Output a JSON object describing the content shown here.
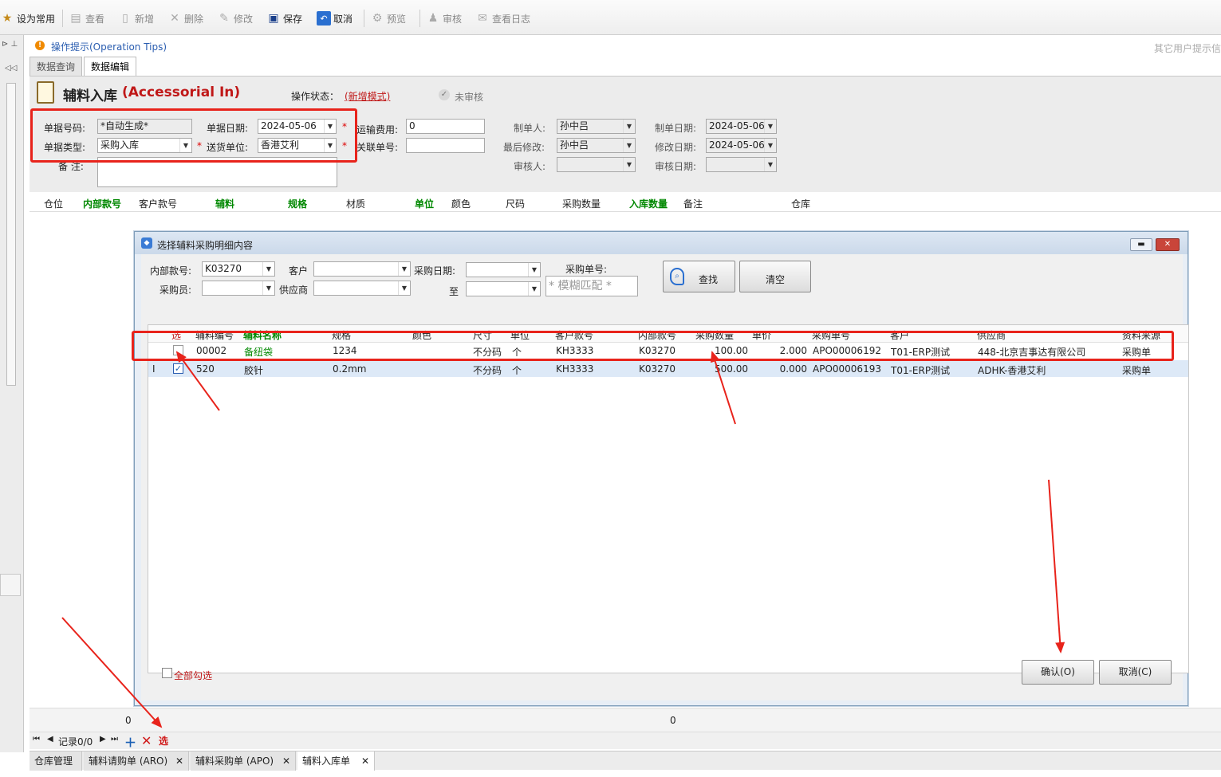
{
  "toolbar": {
    "set_common": "设为常用",
    "view": "查看",
    "add": "新增",
    "delete": "删除",
    "edit": "修改",
    "save": "保存",
    "cancel": "取消",
    "preview": "预览",
    "audit": "审核",
    "view_log": "查看日志"
  },
  "tips": {
    "label": "操作提示(Operation Tips)",
    "right": "其它用户提示信"
  },
  "tabs": [
    "数据查询",
    "数据编辑"
  ],
  "form": {
    "title_cn": "辅料入库",
    "title_en": "(Accessorial In)",
    "status_label": "操作状态：",
    "status_value": "(新增模式)",
    "audit_state": "未审核",
    "doc_no_label": "单据号码:",
    "doc_no_value": "*自动生成*",
    "doc_date_label": "单据日期:",
    "doc_date_value": "2024-05-06",
    "doc_type_label": "单据类型:",
    "doc_type_value": "采购入库",
    "delivery_label": "送货单位:",
    "delivery_value": "香港艾利",
    "freight_label": "运输费用:",
    "freight_value": "0",
    "related_label": "关联单号:",
    "related_value": "",
    "remark_label": "备  注:",
    "maker_label": "制单人:",
    "maker_value": "孙中吕",
    "last_mod_label": "最后修改:",
    "last_mod_value": "孙中吕",
    "auditor_label": "审核人:",
    "make_date_label": "制单日期:",
    "make_date_value": "2024-05-06",
    "mod_date_label": "修改日期:",
    "mod_date_value": "2024-05-06",
    "audit_date_label": "审核日期:"
  },
  "grid_headers": [
    "仓位",
    "内部款号",
    "客户款号",
    "辅料",
    "规格",
    "材质",
    "单位",
    "颜色",
    "尺码",
    "采购数量",
    "入库数量",
    "备注",
    "仓库"
  ],
  "dialog": {
    "title": "选择辅料采购明细内容",
    "inner_no_label": "内部款号:",
    "inner_no_value": "K03270",
    "customer_label": "客户",
    "purchase_date_label": "采购日期:",
    "to_label": "至",
    "purchase_no_label": "采购单号:",
    "purchase_no_placeholder": "* 模糊匹配 *",
    "buyer_label": "采购员:",
    "supplier_label": "供应商",
    "search_btn": "查找",
    "clear_btn": "清空",
    "headers": [
      "选",
      "辅料编号",
      "辅料名称",
      "规格",
      "颜色",
      "尺寸",
      "单位",
      "客户款号",
      "内部款号",
      "采购数量",
      "单价",
      "采购单号",
      "客户",
      "供应商",
      "资料来源"
    ],
    "rows": [
      {
        "checked": false,
        "code": "00002",
        "name": "备纽袋",
        "spec": "1234",
        "color": "",
        "size": "不分码",
        "unit": "个",
        "cust_no": "KH3333",
        "inner_no": "K03270",
        "qty": "100.00",
        "price": "2.000",
        "po": "APO00006192",
        "customer": "T01-ERP测试",
        "supplier": "448-北京吉事达有限公司",
        "source": "采购单"
      },
      {
        "checked": true,
        "code": "520",
        "name": "胶针",
        "spec": "0.2mm",
        "color": "",
        "size": "不分码",
        "unit": "个",
        "cust_no": "KH3333",
        "inner_no": "K03270",
        "qty": "500.00",
        "price": "0.000",
        "po": "APO00006193",
        "customer": "T01-ERP测试",
        "supplier": "ADHK-香港艾利",
        "source": "采购单"
      }
    ],
    "row_indicator": "I",
    "select_all": "全部勾选",
    "confirm_btn": "确认(O)",
    "cancel_btn": "取消(C)"
  },
  "summary": {
    "left": "0",
    "mid": "0"
  },
  "nav": {
    "record": "记录0/0",
    "select": "选"
  },
  "bottom_tabs": [
    "仓库管理",
    "辅料请购单 (ARO)",
    "辅料采购单 (APO)",
    "辅料入库单"
  ]
}
